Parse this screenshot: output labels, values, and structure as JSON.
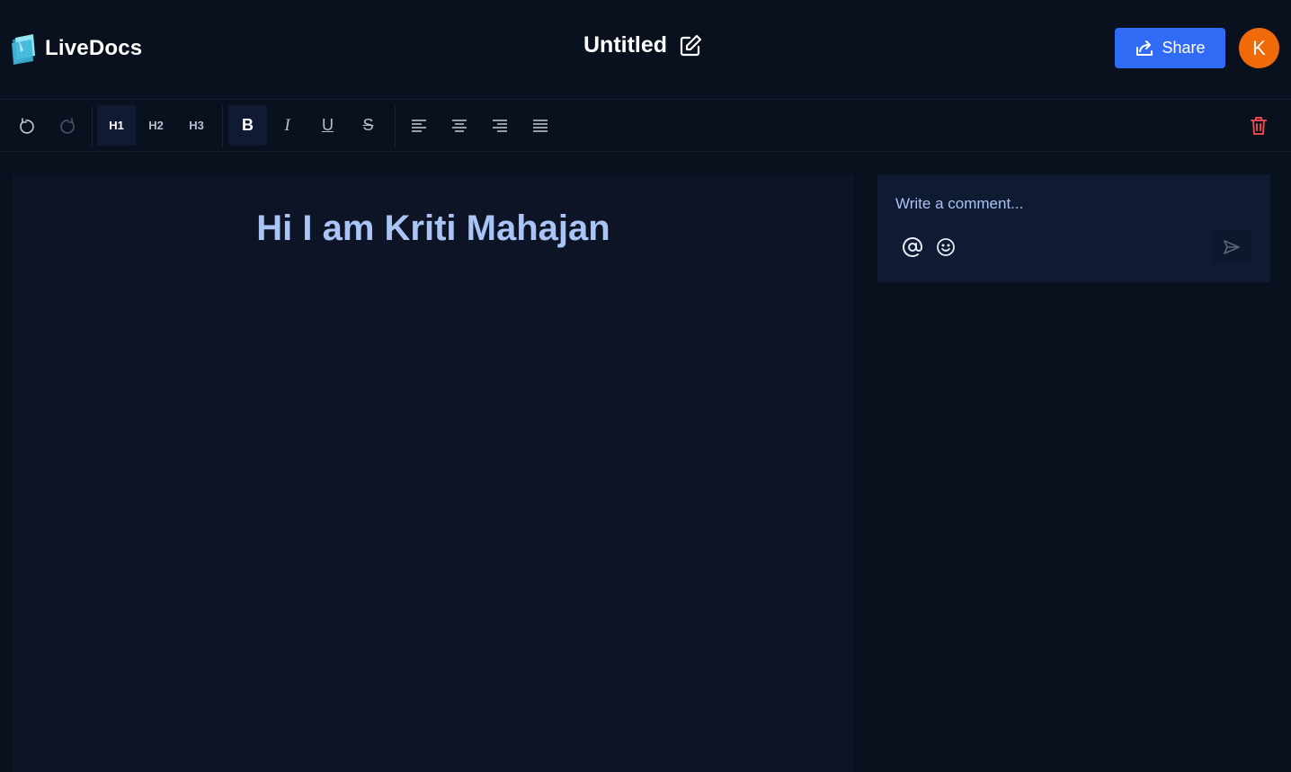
{
  "header": {
    "app_name": "LiveDocs",
    "doc_title": "Untitled",
    "share_label": "Share",
    "avatar_initial": "K"
  },
  "toolbar": {
    "h1": "H1",
    "h2": "H2",
    "h3": "H3",
    "bold": "B",
    "italic": "I",
    "underline": "U",
    "strike": "S"
  },
  "editor": {
    "heading": "Hi I am Kriti Mahajan"
  },
  "comments": {
    "placeholder": "Write a comment..."
  },
  "colors": {
    "background": "#09111f",
    "editor_bg": "#0c1426",
    "accent": "#2f6bf5",
    "avatar": "#f06a0a",
    "heading_text": "#a9c4f5",
    "danger": "#e5484d"
  },
  "icons": [
    "logo-icon",
    "edit-icon",
    "share-icon",
    "undo-icon",
    "redo-icon",
    "align-left-icon",
    "align-center-icon",
    "align-right-icon",
    "align-justify-icon",
    "trash-icon",
    "at-icon",
    "emoji-icon",
    "send-icon"
  ]
}
